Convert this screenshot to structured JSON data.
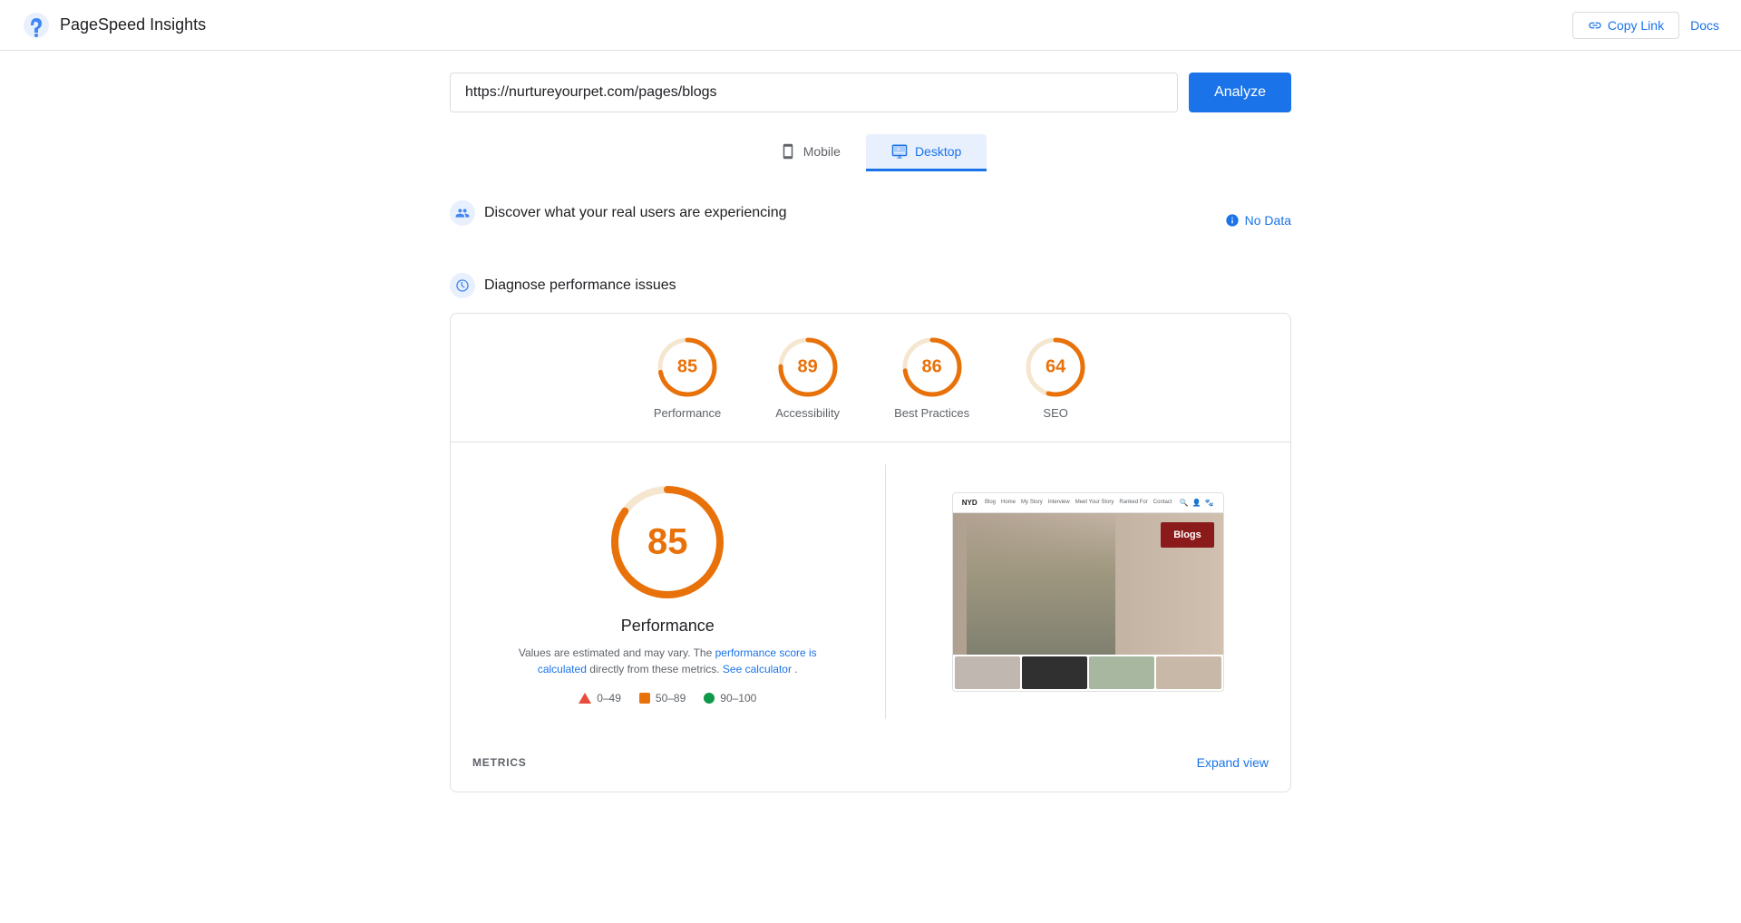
{
  "header": {
    "logo_text": "PageSpeed Insights",
    "copy_link_label": "Copy Link",
    "docs_label": "Docs"
  },
  "search": {
    "url_value": "https://nurtureyourpet.com/pages/blogs",
    "url_placeholder": "Enter a web page URL",
    "analyze_label": "Analyze"
  },
  "mode_tabs": [
    {
      "id": "mobile",
      "label": "Mobile",
      "active": false
    },
    {
      "id": "desktop",
      "label": "Desktop",
      "active": true
    }
  ],
  "real_users": {
    "section_title": "Discover what your real users are experiencing",
    "no_data_label": "No Data"
  },
  "diagnose": {
    "section_title": "Diagnose performance issues"
  },
  "scores": [
    {
      "id": "performance",
      "value": "85",
      "label": "Performance",
      "color": "#e8710a",
      "stroke_color": "#e8710a",
      "percent": 85
    },
    {
      "id": "accessibility",
      "value": "89",
      "label": "Accessibility",
      "color": "#e8710a",
      "stroke_color": "#e8710a",
      "percent": 89
    },
    {
      "id": "best-practices",
      "value": "86",
      "label": "Best Practices",
      "color": "#e8710a",
      "stroke_color": "#e8710a",
      "percent": 86
    },
    {
      "id": "seo",
      "value": "64",
      "label": "SEO",
      "color": "#e8710a",
      "stroke_color": "#e8710a",
      "percent": 64
    }
  ],
  "main_score": {
    "value": "85",
    "title": "Performance",
    "desc_text": "Values are estimated and may vary. The",
    "desc_link1": "performance score is calculated",
    "desc_mid": "directly from these metrics.",
    "desc_link2": "See calculator",
    "desc_end": "."
  },
  "legend": [
    {
      "type": "red",
      "range": "0–49"
    },
    {
      "type": "orange",
      "range": "50–89"
    },
    {
      "type": "green",
      "range": "90–100"
    }
  ],
  "metrics_bar": {
    "label": "METRICS",
    "expand_label": "Expand view"
  },
  "screenshot": {
    "nav_logo": "NYD",
    "nav_links": [
      "Blog",
      "Home",
      "My Story",
      "Interview",
      "Meet Your Story",
      "Ranked For",
      "Contact"
    ],
    "blogs_label": "Blogs"
  }
}
